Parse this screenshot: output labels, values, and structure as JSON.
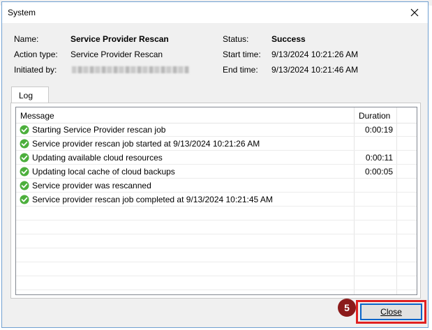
{
  "window": {
    "title": "System"
  },
  "info": {
    "name_label": "Name:",
    "name_value": "Service Provider Rescan",
    "action_label": "Action type:",
    "action_value": "Service Provider Rescan",
    "initiated_label": "Initiated by:",
    "status_label": "Status:",
    "status_value": "Success",
    "start_label": "Start time:",
    "start_value": "9/13/2024 10:21:26 AM",
    "end_label": "End time:",
    "end_value": "9/13/2024 10:21:46 AM"
  },
  "tabs": [
    {
      "label": "Log"
    }
  ],
  "log": {
    "columns": {
      "message": "Message",
      "duration": "Duration"
    },
    "rows": [
      {
        "message": "Starting Service Provider rescan job",
        "duration": "0:00:19",
        "icon": "success-check-icon"
      },
      {
        "message": "Service provider rescan job started at 9/13/2024 10:21:26 AM",
        "duration": "",
        "icon": "success-check-icon"
      },
      {
        "message": "Updating available cloud resources",
        "duration": "0:00:11",
        "icon": "success-check-icon"
      },
      {
        "message": "Updating local cache of cloud backups",
        "duration": "0:00:05",
        "icon": "success-check-icon"
      },
      {
        "message": "Service provider was rescanned",
        "duration": "",
        "icon": "success-check-icon"
      },
      {
        "message": "Service provider rescan job completed at 9/13/2024 10:21:45 AM",
        "duration": "",
        "icon": "success-check-icon"
      }
    ]
  },
  "annotation": {
    "step": "5"
  },
  "buttons": {
    "close_label": "Close"
  },
  "colors": {
    "success": "#4caf3c",
    "highlight": "#e02020",
    "badge": "#8b1a1a",
    "accent": "#0a64c8"
  }
}
